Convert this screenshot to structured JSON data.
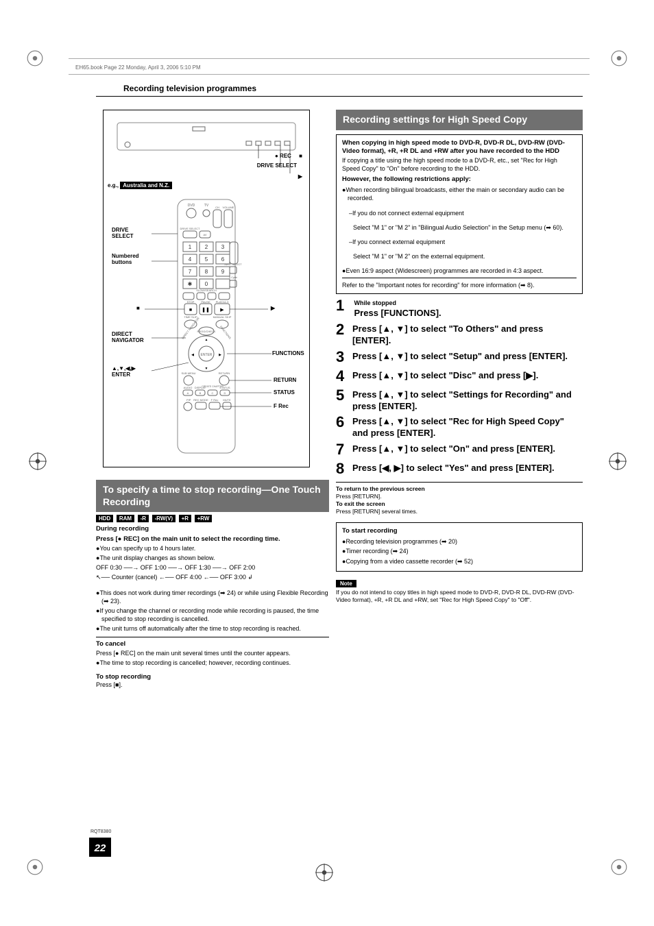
{
  "header": "EH65.book  Page 22  Monday, April 3, 2006  5:10 PM",
  "section_title": "Recording television programmes",
  "rqt": "RQT8380",
  "page_number": "22",
  "remote": {
    "eg_label": "e.g.,",
    "region_badge": "Australia and N.Z.",
    "labels": {
      "drive_select_top": "DRIVE SELECT",
      "rec": "●  REC",
      "stop_top": "■",
      "play_top": "▶",
      "drive_select_left": "DRIVE SELECT",
      "numbered": "Numbered buttons",
      "stop_left": "■",
      "play_right": "▶",
      "direct_nav": "DIRECT NAVIGATOR",
      "functions": "FUNCTIONS",
      "arrows_enter": "▲,▼,◀,▶ ENTER",
      "return": "RETURN",
      "status": "STATUS",
      "frec": "F Rec"
    }
  },
  "left": {
    "bar": "To specify a time to stop recording—One Touch Recording",
    "badges": [
      "HDD",
      "RAM",
      "-R",
      "-RW(V)",
      "+R",
      "+RW"
    ],
    "during": "During recording",
    "press_rec": "Press [● REC] on the main unit to select the recording time.",
    "b1": "You can specify up to 4 hours later.",
    "b2": "The unit display changes as shown below.",
    "timeline": "OFF 0:30  ──→  OFF 1:00   ──→  OFF 1:30   ──→  OFF 2:00",
    "timeline2": "↖──  Counter (cancel)   ←──  OFF 4:00   ←──  OFF 3:00  ↲",
    "b3": "This does not work during timer recordings (➡ 24) or while using Flexible Recording (➡ 23).",
    "b4": "If you change the channel or recording mode while recording is paused, the time specified to stop recording is cancelled.",
    "b5": "The unit turns off automatically after the time to stop recording is reached.",
    "to_cancel_h": "To cancel",
    "to_cancel": "Press [● REC] on the main unit several times until the counter appears.",
    "to_cancel_b": "The time to stop recording is cancelled; however, recording continues.",
    "to_stop_h": "To stop recording",
    "to_stop": "Press [■]."
  },
  "right": {
    "bar": "Recording settings for High Speed Copy",
    "box": {
      "l1": "When copying in high speed mode to DVD-R, DVD-R DL, DVD-RW (DVD-Video format), +R, +R DL and +RW after you have recorded to the HDD",
      "l2": "If copying a title using the high speed mode to a DVD-R, etc., set \"Rec for High Speed Copy\" to \"On\" before recording to the HDD.",
      "l3": "However, the following restrictions apply:",
      "b1": "When recording bilingual broadcasts, either the main or secondary audio can be recorded.",
      "b1a": "–If you do not connect external equipment",
      "b1a2": "Select \"M 1\" or \"M 2\" in \"Bilingual Audio Selection\" in the Setup menu (➡ 60).",
      "b1b": "–If you connect external equipment",
      "b1b2": "Select \"M 1\" or \"M 2\" on the external equipment.",
      "b2": "Even 16:9 aspect (Widescreen) programmes are recorded in 4:3 aspect.",
      "l4": "Refer to the \"Important notes for recording\" for more information (➡ 8)."
    },
    "steps": [
      {
        "pre": "While stopped",
        "text": "Press [FUNCTIONS]."
      },
      {
        "text": "Press [▲, ▼] to select \"To Others\" and press [ENTER]."
      },
      {
        "text": "Press [▲, ▼] to select \"Setup\" and press [ENTER]."
      },
      {
        "text": "Press [▲, ▼] to select \"Disc\" and press [▶]."
      },
      {
        "text": "Press [▲, ▼] to select \"Settings for Recording\" and press [ENTER]."
      },
      {
        "text": "Press [▲, ▼] to select \"Rec for High Speed Copy\" and press [ENTER]."
      },
      {
        "text": "Press [▲, ▼] to select \"On\" and press [ENTER]."
      },
      {
        "text": "Press [◀, ▶] to select \"Yes\" and press [ENTER]."
      }
    ],
    "ret_h": "To return to the previous screen",
    "ret": "Press [RETURN].",
    "exit_h": "To exit the screen",
    "exit": "Press [RETURN] several times.",
    "start_h": "To start recording",
    "start_b1": "Recording television programmes (➡ 20)",
    "start_b2": "Timer recording (➡ 24)",
    "start_b3": "Copying from a video cassette recorder (➡ 52)",
    "note_label": "Note",
    "note": "If you do not intend to copy titles in high speed mode to DVD-R, DVD-R DL, DVD-RW (DVD-Video format), +R, +R DL and +RW, set \"Rec for High Speed Copy\" to \"Off\"."
  }
}
